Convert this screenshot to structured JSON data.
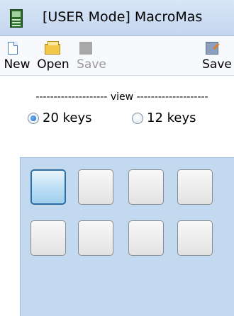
{
  "window": {
    "title": "[USER Mode]  MacroMas",
    "icon": "macro-keypad-icon"
  },
  "toolbar": {
    "items": [
      {
        "label": "New",
        "icon": "new-document-icon",
        "enabled": true
      },
      {
        "label": "Open",
        "icon": "open-folder-icon",
        "enabled": true
      },
      {
        "label": "Save",
        "icon": "save-icon",
        "enabled": false
      },
      {
        "label": "Save",
        "icon": "save-as-icon",
        "enabled": true
      }
    ]
  },
  "view": {
    "label": "-------------------- view --------------------",
    "options": [
      {
        "label": "20 keys",
        "checked": true
      },
      {
        "label": "12 keys",
        "checked": false
      }
    ]
  },
  "keypad": {
    "background": "#c3d9ef",
    "selected_index": 0
  }
}
